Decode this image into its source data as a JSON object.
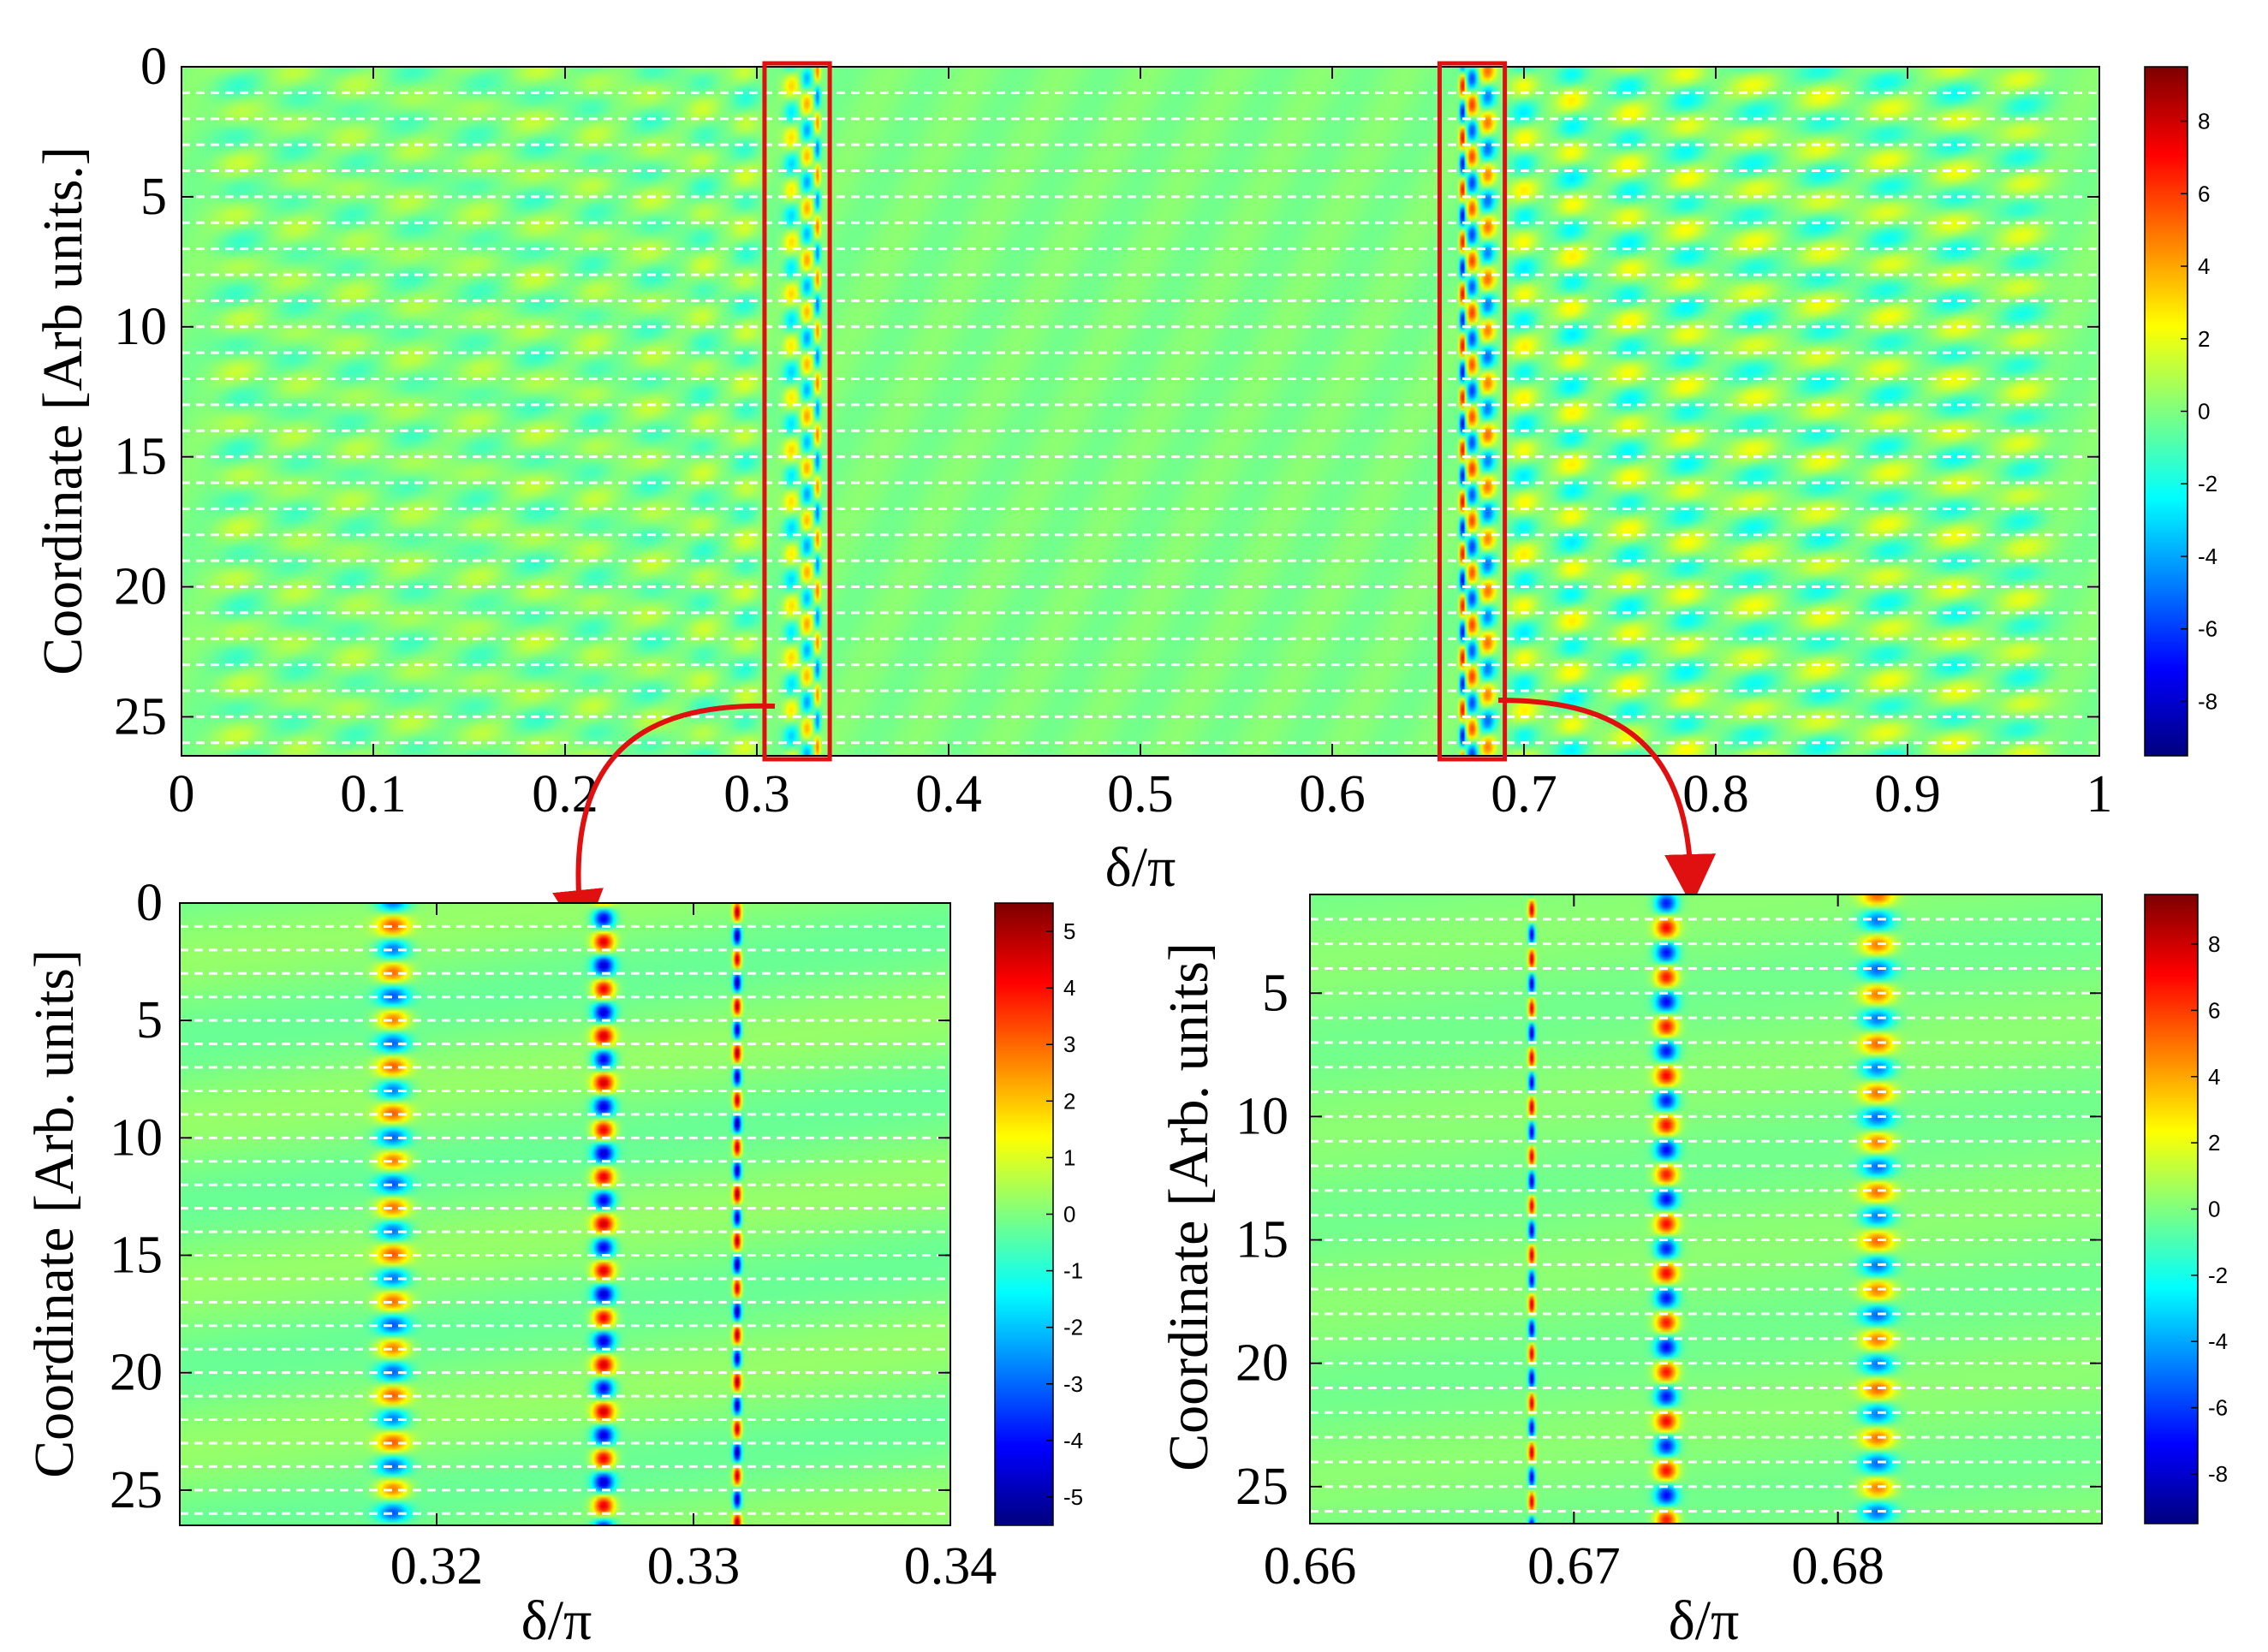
{
  "chart_data": [
    {
      "type": "heatmap",
      "panel": "main",
      "title": "",
      "xlabel": "δ/π",
      "ylabel": "Coordinate [Arb units.]",
      "xlim": [
        0,
        1
      ],
      "ylim": [
        26.5,
        0
      ],
      "x_ticks": [
        0,
        0.1,
        0.2,
        0.3,
        0.4,
        0.5,
        0.6,
        0.7,
        0.8,
        0.9,
        1
      ],
      "x_tick_labels": [
        "0",
        "0.1",
        "0.2",
        "0.3",
        "0.4",
        "0.5",
        "0.6",
        "0.7",
        "0.8",
        "0.9",
        "1"
      ],
      "y_ticks": [
        0,
        5,
        10,
        15,
        20,
        25
      ],
      "y_tick_labels": [
        "0",
        "5",
        "10",
        "15",
        "20",
        "25"
      ],
      "colorbar": {
        "min": -9.5,
        "max": 9.5,
        "ticks": [
          -8,
          -6,
          -4,
          -2,
          0,
          2,
          4,
          6,
          8
        ],
        "tick_labels": [
          "-8",
          "-6",
          "-4",
          "-2",
          "0",
          "2",
          "4",
          "6",
          "8"
        ]
      },
      "colormap": "jet",
      "dashed_lines_y": [
        1,
        2,
        3,
        4,
        5,
        6,
        7,
        8,
        9,
        10,
        11,
        12,
        13,
        14,
        15,
        16,
        17,
        18,
        19,
        20,
        21,
        22,
        23,
        24,
        25,
        26
      ],
      "highlight_boxes": [
        {
          "x": [
            0.304,
            0.338
          ],
          "y": [
            0,
            26.5
          ],
          "color": "#e01010"
        },
        {
          "x": [
            0.656,
            0.69
          ],
          "y": [
            0,
            26.5
          ],
          "color": "#e01010"
        }
      ],
      "bands": [
        {
          "x": 0.03,
          "amp": 1.2,
          "width": 0.012
        },
        {
          "x": 0.06,
          "amp": -1.0,
          "width": 0.012
        },
        {
          "x": 0.09,
          "amp": 1.0,
          "width": 0.012
        },
        {
          "x": 0.12,
          "amp": -1.0,
          "width": 0.012
        },
        {
          "x": 0.155,
          "amp": 1.0,
          "width": 0.012
        },
        {
          "x": 0.185,
          "amp": -1.2,
          "width": 0.012
        },
        {
          "x": 0.215,
          "amp": 1.1,
          "width": 0.01
        },
        {
          "x": 0.245,
          "amp": -1.2,
          "width": 0.01
        },
        {
          "x": 0.272,
          "amp": 1.3,
          "width": 0.008
        },
        {
          "x": 0.294,
          "amp": -1.5,
          "width": 0.007
        },
        {
          "x": 0.318,
          "amp": 3.0,
          "width": 0.004
        },
        {
          "x": 0.326,
          "amp": -4.0,
          "width": 0.003
        },
        {
          "x": 0.3315,
          "amp": 5.0,
          "width": 0.0015
        },
        {
          "x": 0.668,
          "amp": 8.0,
          "width": 0.0015
        },
        {
          "x": 0.673,
          "amp": -6.0,
          "width": 0.003
        },
        {
          "x": 0.681,
          "amp": 5.0,
          "width": 0.004
        },
        {
          "x": 0.7,
          "amp": -2.5,
          "width": 0.007
        },
        {
          "x": 0.725,
          "amp": 2.5,
          "width": 0.008
        },
        {
          "x": 0.755,
          "amp": -2.3,
          "width": 0.009
        },
        {
          "x": 0.785,
          "amp": 2.2,
          "width": 0.01
        },
        {
          "x": 0.82,
          "amp": -2.0,
          "width": 0.012
        },
        {
          "x": 0.855,
          "amp": 2.0,
          "width": 0.012
        },
        {
          "x": 0.89,
          "amp": -2.0,
          "width": 0.012
        },
        {
          "x": 0.925,
          "amp": 2.0,
          "width": 0.012
        },
        {
          "x": 0.96,
          "amp": -1.8,
          "width": 0.012
        }
      ]
    },
    {
      "type": "heatmap",
      "panel": "zoom-left",
      "title": "",
      "xlabel": "δ/π",
      "ylabel": "Coordinate [Arb. units]",
      "xlim": [
        0.31,
        0.34
      ],
      "ylim": [
        26.5,
        0
      ],
      "x_ticks": [
        0.32,
        0.33,
        0.34
      ],
      "x_tick_labels": [
        "0.32",
        "0.33",
        "0.34"
      ],
      "y_ticks": [
        0,
        5,
        10,
        15,
        20,
        25
      ],
      "y_tick_labels": [
        "0",
        "5",
        "10",
        "15",
        "20",
        "25"
      ],
      "colorbar": {
        "min": -5.5,
        "max": 5.5,
        "ticks": [
          -5,
          -4,
          -3,
          -2,
          -1,
          0,
          1,
          2,
          3,
          4,
          5
        ],
        "tick_labels": [
          "-5",
          "-4",
          "-3",
          "-2",
          "-1",
          "0",
          "1",
          "2",
          "3",
          "4",
          "5"
        ]
      },
      "colormap": "jet",
      "dashed_lines_y": [
        1,
        2,
        3,
        4,
        5,
        6,
        7,
        8,
        9,
        10,
        11,
        12,
        13,
        14,
        15,
        16,
        17,
        18,
        19,
        20,
        21,
        22,
        23,
        24,
        25,
        26
      ],
      "bands": [
        {
          "x": 0.3183,
          "amp": 3.0,
          "width": 0.0006
        },
        {
          "x": 0.3265,
          "amp": -4.5,
          "width": 0.0004
        },
        {
          "x": 0.3317,
          "amp": 5.0,
          "width": 0.00015
        }
      ]
    },
    {
      "type": "heatmap",
      "panel": "zoom-right",
      "title": "",
      "xlabel": "δ/π",
      "ylabel": "Coordinate [Arb. units]",
      "xlim": [
        0.66,
        0.69
      ],
      "ylim": [
        26.5,
        1
      ],
      "x_ticks": [
        0.66,
        0.67,
        0.68
      ],
      "x_tick_labels": [
        "0.66",
        "0.67",
        "0.68"
      ],
      "y_ticks": [
        5,
        10,
        15,
        20,
        25
      ],
      "y_tick_labels": [
        "5",
        "10",
        "15",
        "20",
        "25"
      ],
      "colorbar": {
        "min": -9.5,
        "max": 9.5,
        "ticks": [
          -8,
          -6,
          -4,
          -2,
          0,
          2,
          4,
          6,
          8
        ],
        "tick_labels": [
          "-8",
          "-6",
          "-4",
          "-2",
          "0",
          "2",
          "4",
          "6",
          "8"
        ]
      },
      "colormap": "jet",
      "dashed_lines_y": [
        2,
        3,
        4,
        5,
        6,
        7,
        8,
        9,
        10,
        11,
        12,
        13,
        14,
        15,
        16,
        17,
        18,
        19,
        20,
        21,
        22,
        23,
        24,
        25,
        26
      ],
      "bands": [
        {
          "x": 0.6684,
          "amp": 8.0,
          "width": 0.00012
        },
        {
          "x": 0.6735,
          "amp": -7.0,
          "width": 0.0004
        },
        {
          "x": 0.6815,
          "amp": 5.0,
          "width": 0.0006
        }
      ]
    }
  ]
}
